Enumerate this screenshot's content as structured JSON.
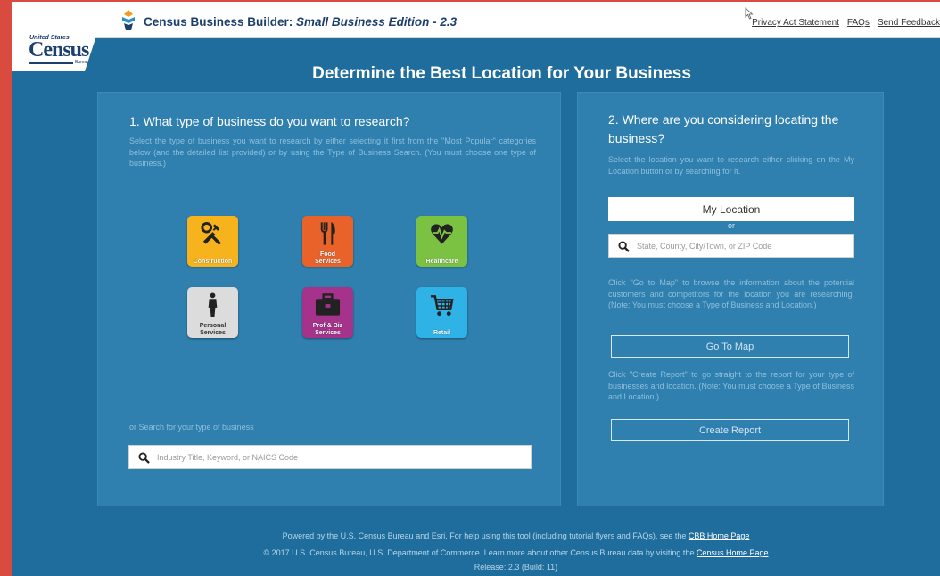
{
  "header": {
    "title_main": "Census Business Builder: ",
    "title_edition": "Small Business Edition - 2.3",
    "links": [
      "Privacy Act Statement",
      "FAQs",
      "Send Feedback"
    ]
  },
  "logo": {
    "line1": "United States",
    "line2": "Census",
    "line3": "Bureau"
  },
  "headline": "Determine the Best Location for Your Business",
  "left_panel": {
    "heading": "1. What type of business do you want to research?",
    "description": "Select the type of business you want to research by either selecting it first from the \"Most Popular\" categories below (and the detailed list provided) or by using the Type of Business Search. (You must choose one type of business.)",
    "tiles": {
      "construction": "Construction",
      "food_1": "Food",
      "food_2": "Services",
      "healthcare": "Healthcare",
      "personal_1": "Personal",
      "personal_2": "Services",
      "prof_1": "Prof & Biz",
      "prof_2": "Services",
      "retail": "Retail"
    },
    "search_label": "or Search for your type of business",
    "search_placeholder": "Industry Title, Keyword, or NAICS Code"
  },
  "right_panel": {
    "heading": "2. Where are you considering locating the business?",
    "description_1": "Select the location you want to research either clicking on the My Location button or by searching for it.",
    "my_location_label": "My Location",
    "or_label": "or",
    "search_placeholder": "State, County, City/Town, or ZIP Code",
    "description_2": "Click \"Go to Map\" to browse the information about the potential customers and competitors for the location you are researching. (Note: You must choose a Type of Business and Location.)",
    "go_to_map_label": "Go To Map",
    "description_3": "Click \"Create Report\" to go straight to the report for your type of businesses and location. (Note: You must choose a Type of Business and Location.)",
    "create_report_label": "Create Report"
  },
  "footer": {
    "line1_text": "Powered by the U.S. Census Bureau and Esri. For help using this tool (including tutorial flyers and FAQs), see the ",
    "line1_link": "CBB Home Page",
    "line2_text": "© 2017 U.S. Census Bureau, U.S. Department of Commerce. Learn more about other Census Bureau data by visiting the ",
    "line2_link": "Census Home Page",
    "line3_text": "Release: 2.3 (Build: 11)"
  },
  "colors": {
    "background": "#1f6d9c",
    "panel": "#2f80af",
    "title": "#1d3f6c",
    "window_border": "#d94b3f"
  }
}
